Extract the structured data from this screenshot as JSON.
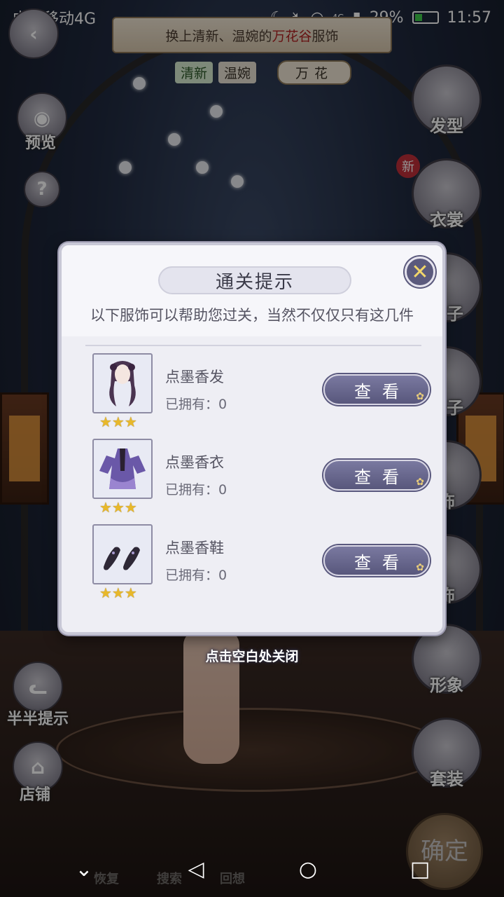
{
  "status_bar": {
    "carrier": "中国移动4G",
    "battery": "29%",
    "time": "11:57",
    "net": "4G"
  },
  "quest": {
    "prefix": "换上清新、温婉的",
    "highlight": "万花谷",
    "suffix": "服饰",
    "tags": [
      "清新",
      "温婉"
    ],
    "theme_tag": "万花"
  },
  "left_menu": {
    "preview": "预览",
    "help": "?",
    "hint": "半半提示",
    "shop": "店铺"
  },
  "right_menu": {
    "hair": "发型",
    "clothes": "衣裳",
    "socks": "袜子",
    "shoes": "鞋子",
    "accessory1": "饰",
    "accessory2": "饰",
    "image": "形象",
    "outfit": "套装",
    "new_badge": "新",
    "confirm": "确定"
  },
  "modal": {
    "title": "通关提示",
    "subtitle": "以下服饰可以帮助您过关，当然不仅仅只有这几件",
    "items": [
      {
        "name": "点墨香发",
        "owned": "已拥有：0",
        "stars": "★★★",
        "button": "查看",
        "icon": "hair-icon"
      },
      {
        "name": "点墨香衣",
        "owned": "已拥有：0",
        "stars": "★★★",
        "button": "查看",
        "icon": "dress-icon"
      },
      {
        "name": "点墨香鞋",
        "owned": "已拥有：0",
        "stars": "★★★",
        "button": "查看",
        "icon": "shoes-icon"
      }
    ],
    "close_symbol": "✕"
  },
  "close_hint": "点击空白处关闭",
  "bottom_hidden": {
    "restore": "恢复",
    "search": "搜索",
    "back": "回想"
  },
  "nav": {
    "collapse": "⌄",
    "back": "◁",
    "home": "○",
    "recents": "□"
  }
}
